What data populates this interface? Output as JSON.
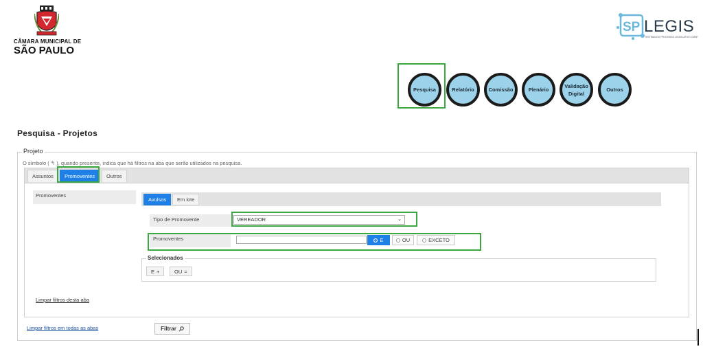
{
  "header": {
    "org_line1": "CÂMARA MUNICIPAL DE",
    "org_line2": "SÃO PAULO",
    "app_logo_mark": "SP",
    "app_logo_word": "LEGIS",
    "app_logo_sub": "SISTEMA DO PROCESSO LEGISLATIVO CMSP"
  },
  "nav": [
    {
      "label": "Pesquisa"
    },
    {
      "label": "Relatório"
    },
    {
      "label": "Comissão"
    },
    {
      "label": "Plenário"
    },
    {
      "label": "Validação Digital"
    },
    {
      "label": "Outros"
    }
  ],
  "page": {
    "title": "Pesquisa - Projetos",
    "fieldset_legend": "Projeto",
    "hint": "O símbolo ( ↰ ), quando presente, indica que há filtros na aba que serão utilizados na pesquisa."
  },
  "tabs": [
    {
      "label": "Assuntos",
      "active": false
    },
    {
      "label": "Promoventes",
      "active": true
    },
    {
      "label": "Outros",
      "active": false
    }
  ],
  "panel": {
    "left_label": "Promoventes",
    "inner_tabs": [
      {
        "label": "Avulsos",
        "active": true
      },
      {
        "label": "Em lote",
        "active": false
      }
    ],
    "tipo_label": "Tipo de Promovente",
    "tipo_value": "VEREADOR",
    "promoventes_label": "Promoventes",
    "promoventes_value": "",
    "logic_options": [
      {
        "label": "E",
        "selected": true
      },
      {
        "label": "OU",
        "selected": false
      },
      {
        "label": "EXCETO",
        "selected": false
      }
    ],
    "selecionados_legend": "Selecionados",
    "chips": [
      {
        "label": "E",
        "symbol": "+"
      },
      {
        "label": "OU",
        "symbol": "="
      }
    ],
    "clear_tab_link": "Limpar filtros desta aba"
  },
  "footer": {
    "clear_all_link": "Limpar filtros em todas as abas",
    "filter_button": "Filtrar",
    "filter_icon": "search-icon"
  },
  "colors": {
    "accent": "#1e80e6",
    "nav_fill": "#9dd3ea",
    "highlight": "#3aa741"
  }
}
